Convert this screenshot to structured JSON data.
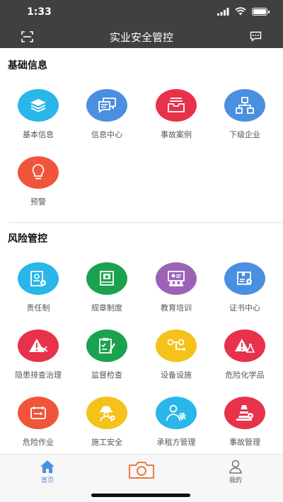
{
  "status": {
    "time": "1:33"
  },
  "header": {
    "title": "实业安全管控"
  },
  "sections": {
    "basic": {
      "title": "基础信息",
      "items": [
        {
          "label": "基本信息",
          "icon": "layers-icon",
          "color": "#29B6E8"
        },
        {
          "label": "信息中心",
          "icon": "messages-icon",
          "color": "#4A8FE0"
        },
        {
          "label": "事故案例",
          "icon": "inbox-icon",
          "color": "#E8314A"
        },
        {
          "label": "下级企业",
          "icon": "org-chart-icon",
          "color": "#4A8FE0"
        },
        {
          "label": "预警",
          "icon": "bulb-icon",
          "color": "#F0553A"
        }
      ]
    },
    "risk": {
      "title": "风险管控",
      "items": [
        {
          "label": "责任制",
          "icon": "document-gear-icon",
          "color": "#29B6E8"
        },
        {
          "label": "规章制度",
          "icon": "book-star-icon",
          "color": "#1BA24E"
        },
        {
          "label": "教育培训",
          "icon": "classroom-icon",
          "color": "#9D62B8"
        },
        {
          "label": "证书中心",
          "icon": "certificate-icon",
          "color": "#4A8FE0"
        },
        {
          "label": "隐患排查治理",
          "icon": "warning-icon",
          "color": "#E8314A"
        },
        {
          "label": "监督检查",
          "icon": "clipboard-check-icon",
          "color": "#1BA24E"
        },
        {
          "label": "设备设施",
          "icon": "equipment-icon",
          "color": "#F5C21C"
        },
        {
          "label": "危险化学品",
          "icon": "chemical-warning-icon",
          "color": "#E8314A"
        },
        {
          "label": "危险作业",
          "icon": "danger-work-icon",
          "color": "#F0553A"
        },
        {
          "label": "施工安全",
          "icon": "worker-icon",
          "color": "#F5C21C"
        },
        {
          "label": "承租方管理",
          "icon": "tenant-icon",
          "color": "#29B6E8"
        },
        {
          "label": "事故管理",
          "icon": "cone-icon",
          "color": "#E8314A"
        }
      ]
    }
  },
  "tabbar": {
    "home": "首页",
    "mine": "我的",
    "active_color": "#4A90E2",
    "camera_color": "#E87A3E"
  }
}
